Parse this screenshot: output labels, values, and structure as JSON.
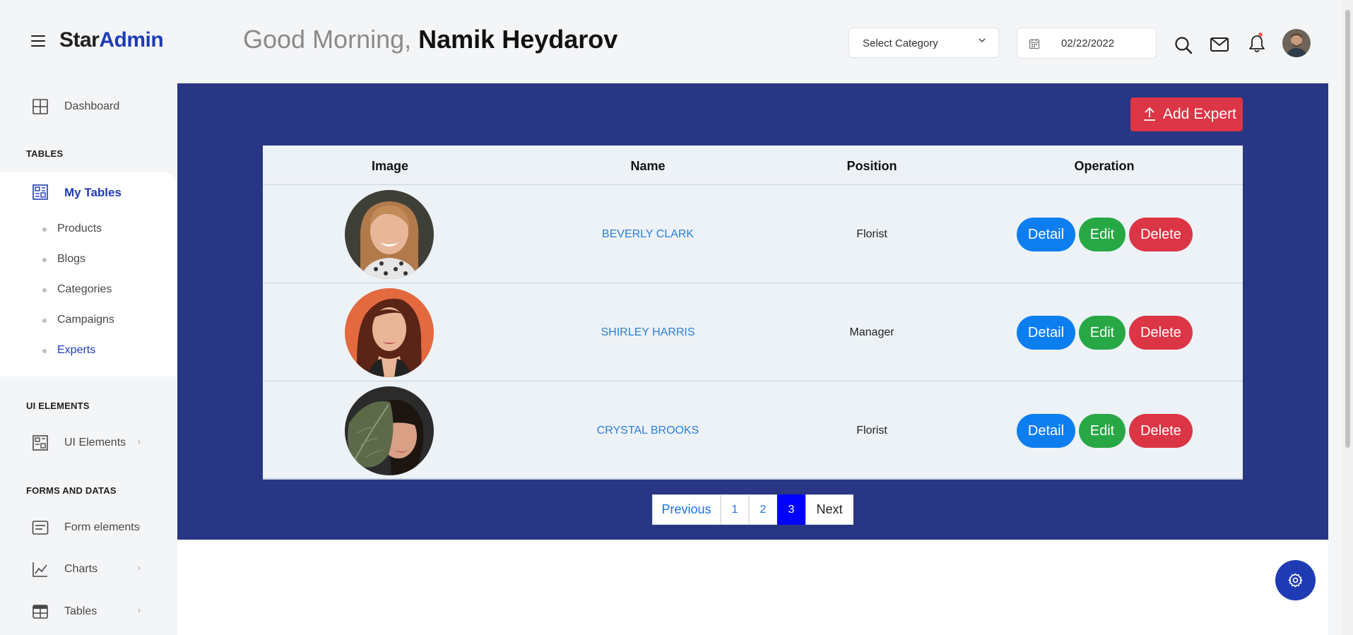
{
  "header": {
    "brand_part1": "Star",
    "brand_part2": "Admin",
    "greeting": "Good Morning, ",
    "user_name": "Namik Heydarov",
    "category_select": "Select Category",
    "date": "02/22/2022"
  },
  "sidebar": {
    "dashboard": "Dashboard",
    "cat_tables": "TABLES",
    "my_tables": "My Tables",
    "sub_items": [
      "Products",
      "Blogs",
      "Categories",
      "Campaigns",
      "Experts"
    ],
    "cat_ui": "UI ELEMENTS",
    "ui_elements": "UI Elements",
    "cat_forms": "FORMS AND DATAS",
    "form_elements": "Form elements",
    "charts": "Charts",
    "tables": "Tables"
  },
  "main": {
    "add_button": "Add Expert",
    "columns": [
      "Image",
      "Name",
      "Position",
      "Operation"
    ],
    "rows": [
      {
        "name": "BEVERLY CLARK",
        "position": "Florist"
      },
      {
        "name": "SHIRLEY HARRIS",
        "position": "Manager"
      },
      {
        "name": "CRYSTAL BROOKS",
        "position": "Florist"
      }
    ],
    "btn_detail": "Detail",
    "btn_edit": "Edit",
    "btn_delete": "Delete",
    "pager": {
      "prev": "Previous",
      "pages": [
        "1",
        "2",
        "3"
      ],
      "active_page": "3",
      "next": "Next"
    }
  },
  "colors": {
    "accent": "#1f3bb3",
    "panel": "#283683",
    "danger": "#dc3545",
    "success": "#28a745",
    "primary": "#0d7ef0"
  }
}
